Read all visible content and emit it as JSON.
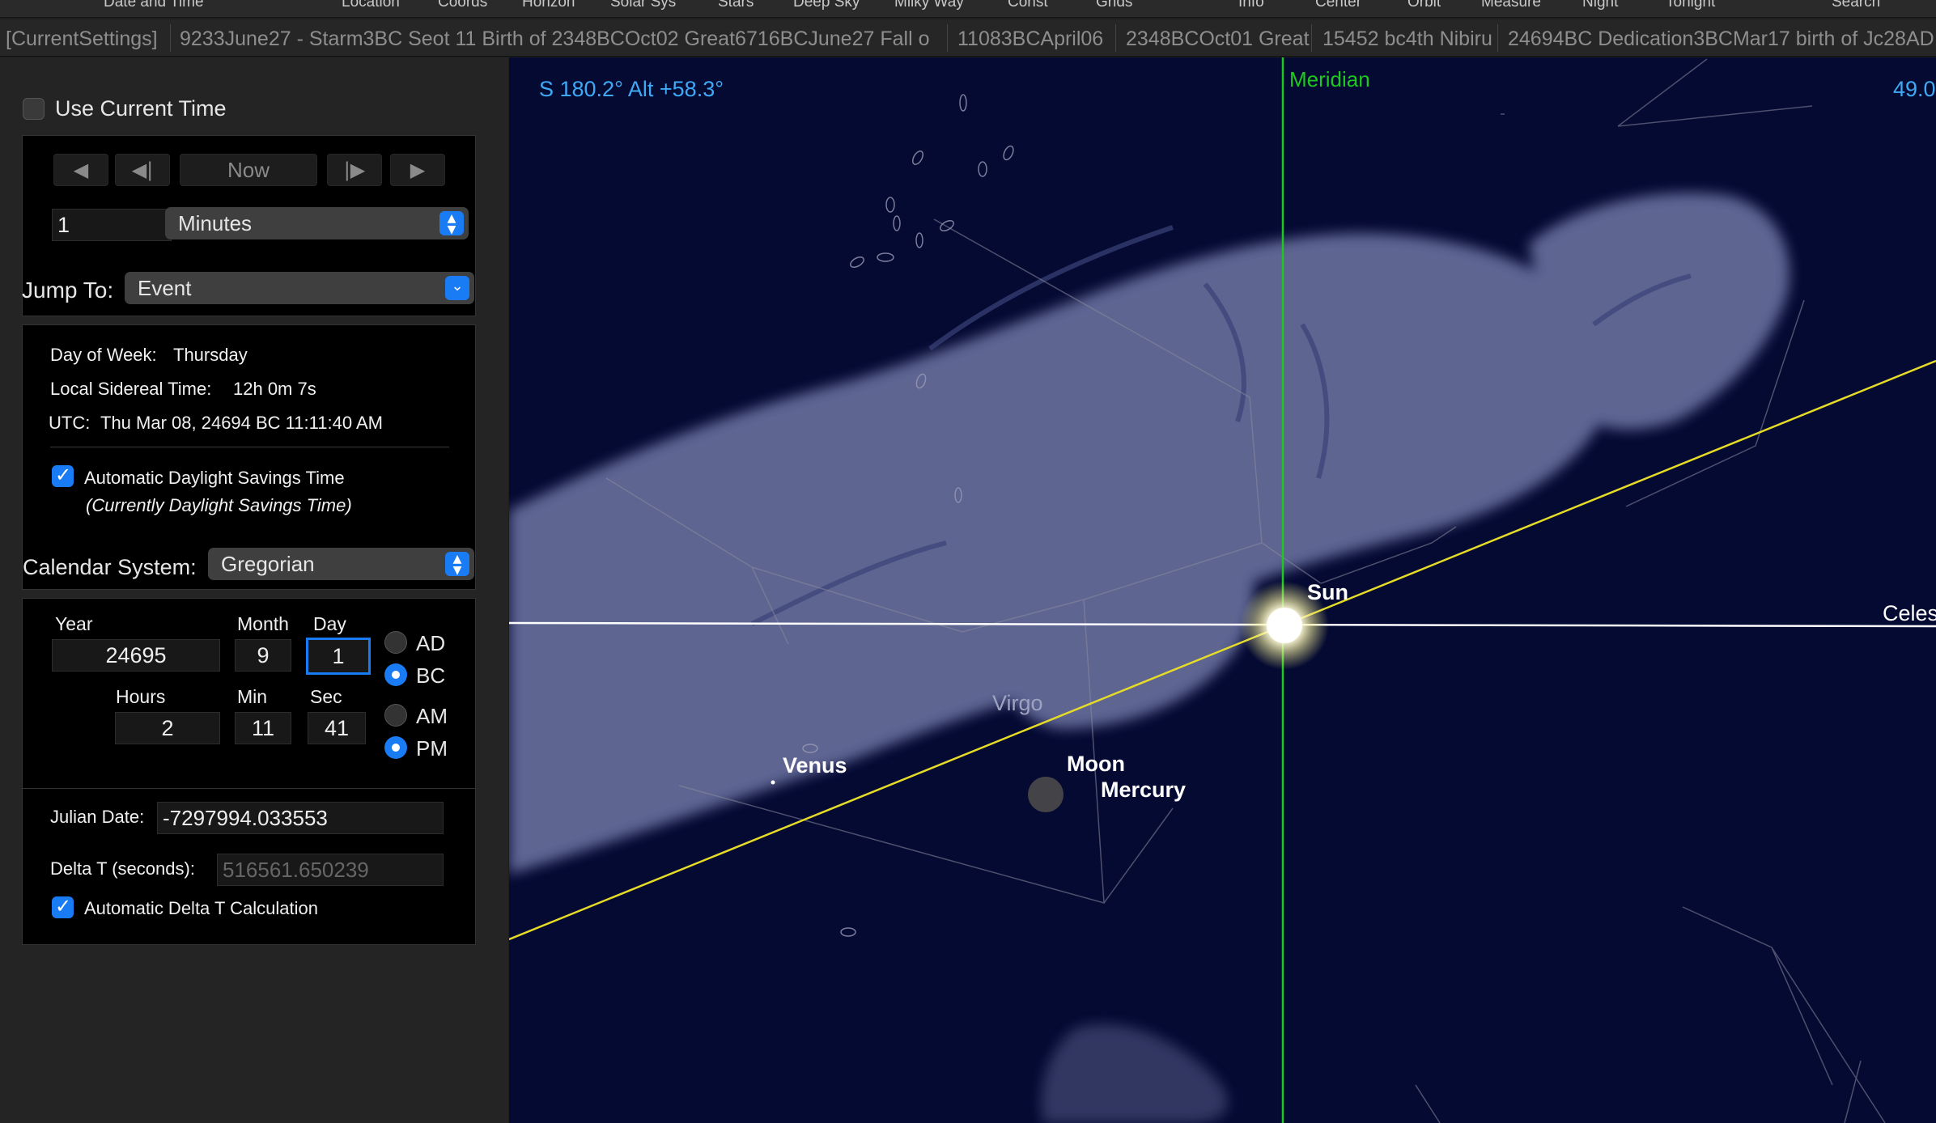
{
  "toolbar": {
    "items": [
      "Date and Time",
      "Location",
      "Coords",
      "Horizon",
      "Solar Sys",
      "Stars",
      "Deep Sky",
      "Milky Way",
      "Const",
      "Grids",
      "Info",
      "Center",
      "Orbit",
      "Measure",
      "Night",
      "Tonight",
      "Search"
    ]
  },
  "settings_bar": {
    "items": [
      "[CurrentSettings]",
      "9233June27 - Starm3BC Seot 11 Birth of 2348BCOct02 Great6716BCJune27 Fall o",
      "11083BCApril06",
      "2348BCOct01 Great",
      "15452 bc4th Nibiru",
      "24694BC Dedication3BCMar17 birth of Jc28AD"
    ]
  },
  "time_panel": {
    "use_current_time_label": "Use Current Time",
    "use_current_time_checked": false,
    "controls": {
      "rewind_glyph": "◀",
      "step_back_glyph": "◀|",
      "now_label": "Now",
      "step_forward_glyph": "|▶",
      "play_glyph": "▶"
    },
    "step_value": "1",
    "step_unit": "Minutes",
    "jump_to_label": "Jump To:",
    "jump_to_value": "Event"
  },
  "info": {
    "day_of_week_label": "Day of Week:",
    "day_of_week": "Thursday",
    "sidereal_label": "Local Sidereal Time:",
    "sidereal_time": "12h 0m 7s",
    "utc_label": "UTC:",
    "utc_value": "Thu Mar 08, 24694 BC 11:11:40 AM",
    "auto_dst_label": "Automatic Daylight Savings Time",
    "auto_dst_checked": true,
    "dst_status": "(Currently Daylight Savings Time)"
  },
  "calendar": {
    "label": "Calendar System:",
    "value": "Gregorian",
    "year_label": "Year",
    "year": "24695",
    "month_label": "Month",
    "month": "9",
    "day_label": "Day",
    "day": "1",
    "era_ad": "AD",
    "era_bc": "BC",
    "era_selected": "BC",
    "hours_label": "Hours",
    "hours": "2",
    "min_label": "Min",
    "min": "11",
    "sec_label": "Sec",
    "sec": "41",
    "am": "AM",
    "pm": "PM",
    "ampm_selected": "PM"
  },
  "julian": {
    "julian_label": "Julian Date:",
    "julian_value": "-7297994.033553",
    "delta_t_label": "Delta T (seconds):",
    "delta_t_value": "516561.650239",
    "auto_delta_t_label": "Automatic Delta T Calculation",
    "auto_delta_t_checked": true
  },
  "sky": {
    "direction_readout": "S 180.2° Alt +58.3°",
    "right_readout": "49.0",
    "meridian_label": "Meridian",
    "celestial_label": "Celes",
    "constellation_label": "Virgo",
    "objects": [
      "Sun",
      "Moon",
      "Mercury",
      "Venus"
    ],
    "colors": {
      "background": "#050a33",
      "meridian": "#1ec81e",
      "ecliptic": "#e6dc28",
      "equator": "#ffffff",
      "readout": "#3fa9f5",
      "constellation_art": "#7d84b2"
    }
  }
}
